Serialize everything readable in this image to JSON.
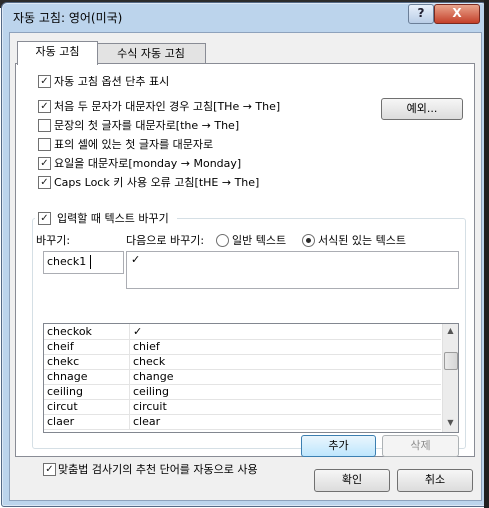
{
  "window": {
    "title": "자동 고침: 영어(미국)",
    "help_label": "?",
    "close_label": "X"
  },
  "tabs": [
    {
      "label": "자동 고침",
      "active": true
    },
    {
      "label": "수식 자동 고침",
      "active": false
    }
  ],
  "options": {
    "show_buttons": {
      "label": "자동 고침 옵션 단추 표시",
      "checked": true
    },
    "two_initial_caps": {
      "label": "처음 두 문자가 대문자인 경우 고침[THe → The]",
      "checked": true
    },
    "first_letter_sentences": {
      "label": "문장의 첫 글자를 대문자로[the → The]",
      "checked": false
    },
    "first_letter_cells": {
      "label": "표의 셀에 있는 첫 글자를 대문자로",
      "checked": false
    },
    "capitalize_days": {
      "label": "요일을 대문자로[monday → Monday]",
      "checked": true
    },
    "caps_lock": {
      "label": "Caps Lock 키 사용 오류 고침[tHE → The]",
      "checked": true
    }
  },
  "exceptions_button": "예외...",
  "replace_as_you_type": {
    "label": "입력할 때 텍스트 바꾸기",
    "checked": true
  },
  "replace_label": "바꾸기:",
  "with_label": "다음으로 바꾸기:",
  "radio_plain": {
    "label": "일반 텍스트",
    "selected": false
  },
  "radio_formatted": {
    "label": "서식된 있는 텍스트",
    "selected": true
  },
  "replace_value": "check1",
  "with_value": "✓",
  "entries": [
    {
      "from": "checkok",
      "to": "✓"
    },
    {
      "from": "cheif",
      "to": "chief"
    },
    {
      "from": "chekc",
      "to": "check"
    },
    {
      "from": "chnage",
      "to": "change"
    },
    {
      "from": "ceiling",
      "to": "ceiling"
    },
    {
      "from": "circut",
      "to": "circuit"
    },
    {
      "from": "claer",
      "to": "clear"
    }
  ],
  "add_button": "추가",
  "delete_button": "삭제",
  "spellcheck_suggestions": {
    "label": "맞춤법 검사기의 추천 단어를 자동으로 사용",
    "checked": true
  },
  "ok_button": "확인",
  "cancel_button": "취소",
  "icons": {
    "checkmark": "✓",
    "radio_dot": "●",
    "scroll_up": "▲",
    "scroll_down": "▼"
  }
}
